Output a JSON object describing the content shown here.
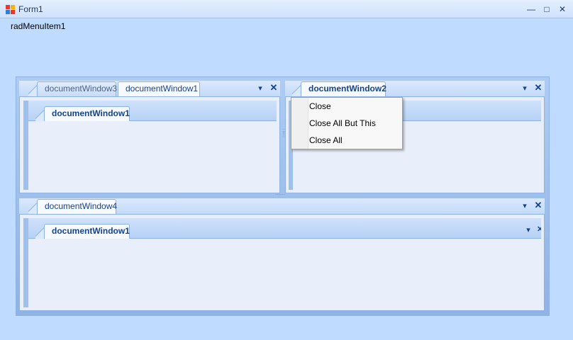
{
  "window": {
    "title": "Form1",
    "minimize_glyph": "—",
    "maximize_glyph": "□",
    "close_glyph": "✕"
  },
  "menu": {
    "item_label": "radMenuItem1"
  },
  "top_left_pane": {
    "tabs": [
      "documentWindow3",
      "documentWindow1"
    ],
    "active_tab": "documentWindow1",
    "inner_tab": "documentWindow1"
  },
  "top_right_pane": {
    "tabs": [
      "documentWindow2"
    ],
    "active_tab": "documentWindow2"
  },
  "bottom_pane": {
    "tabs": [
      "documentWindow4"
    ],
    "active_tab": "documentWindow4",
    "inner_tab": "documentWindow1"
  },
  "context_menu": {
    "items": [
      "Close",
      "Close All But This",
      "Close All"
    ]
  },
  "glyphs": {
    "dropdown": "▾",
    "close": "✕"
  },
  "colors": {
    "form_background": "#bfdbff",
    "accent_text": "#15428b"
  }
}
